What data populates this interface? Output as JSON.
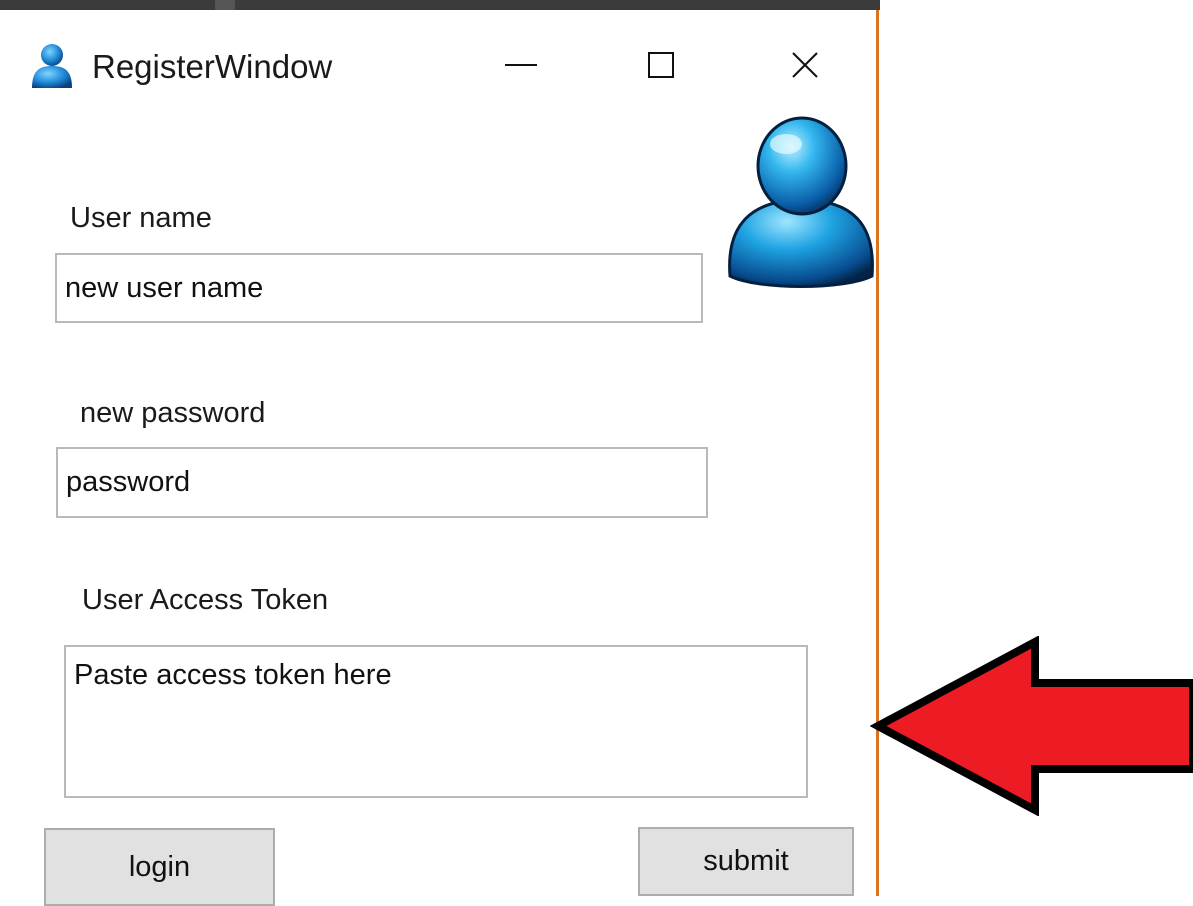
{
  "window": {
    "title": "RegisterWindow",
    "accent_border_color": "#d9731f",
    "icon": "user-icon"
  },
  "titlebar_buttons": {
    "minimize_icon": "minimize-icon",
    "maximize_icon": "maximize-icon",
    "close_icon": "close-icon"
  },
  "avatar": {
    "icon": "user-avatar-icon"
  },
  "form": {
    "username_label": "User name",
    "username_value": "new user name",
    "password_label": "new password",
    "password_value": "password",
    "token_label": "User Access Token",
    "token_value": "Paste access token here"
  },
  "buttons": {
    "login_label": "login",
    "submit_label": "submit"
  },
  "annotation": {
    "arrow_color": "#ed1c24",
    "arrow_icon": "left-arrow-icon"
  }
}
